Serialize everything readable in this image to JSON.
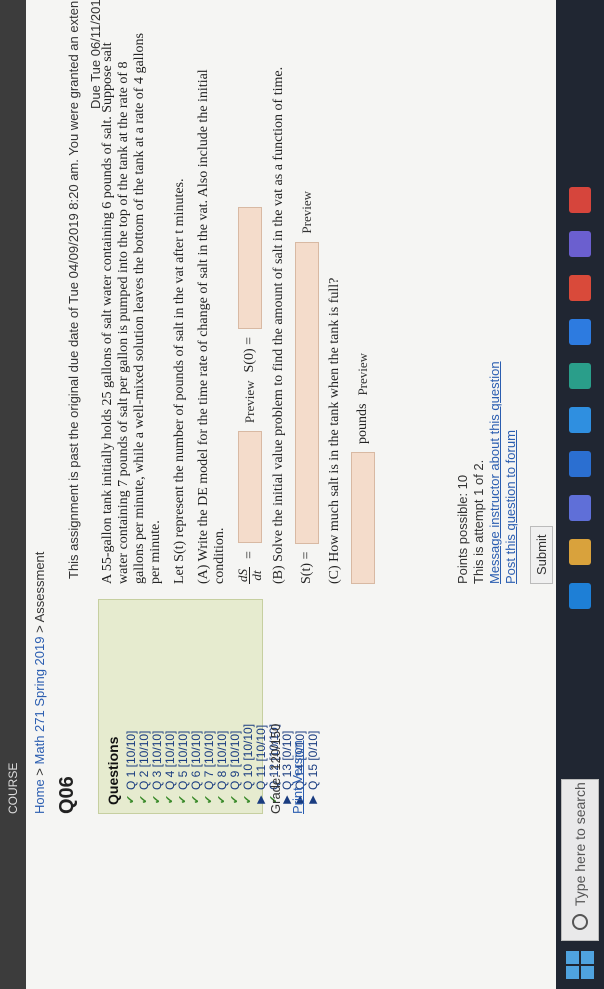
{
  "taskbar": {
    "search_placeholder": "Type here to search",
    "apps": [
      "edge-icon",
      "explorer-icon",
      "store-icon",
      "word-icon",
      "mail-icon",
      "maps-icon",
      "photos-icon",
      "media-icon",
      "teams-icon",
      "chrome-icon"
    ]
  },
  "header": {
    "brand": "COURSE",
    "breadcrumb": {
      "home": "Home",
      "sep": ">",
      "course": "Math 271 Spring 2019",
      "page": "Assessment"
    },
    "title": "Q06",
    "past_due": "This assignment is past the original due date of Tue 04/09/2019 8:20 am. You were granted an exten",
    "due": "Due Tue 06/11/2019 11:"
  },
  "sidebar": {
    "title": "Questions",
    "items": [
      {
        "label": "Q 1 [10/10]",
        "mark": "✔"
      },
      {
        "label": "Q 2 [10/10]",
        "mark": "✔"
      },
      {
        "label": "Q 3 [10/10]",
        "mark": "✔"
      },
      {
        "label": "Q 4 [10/10]",
        "mark": "✔"
      },
      {
        "label": "Q 5 [10/10]",
        "mark": "✔"
      },
      {
        "label": "Q 6 [10/10]",
        "mark": "✔"
      },
      {
        "label": "Q 7 [10/10]",
        "mark": "✔"
      },
      {
        "label": "Q 8 [10/10]",
        "mark": "✔"
      },
      {
        "label": "Q 9 [10/10]",
        "mark": "✔"
      },
      {
        "label": "Q 10 [10/10]",
        "mark": "✔"
      },
      {
        "label": "Q 11 [10/10]",
        "mark": "▶"
      },
      {
        "label": "Q 12 [10/10]",
        "mark": "✔"
      },
      {
        "label": "Q 13 [0/10]",
        "mark": "▶"
      },
      {
        "label": "Q 14 [0/10]",
        "mark": "▶"
      },
      {
        "label": "Q 15 [0/10]",
        "mark": "▶"
      }
    ],
    "grade": "Grade: 120/150",
    "print": "Print Version"
  },
  "question": {
    "prompt": "A 55-gallon tank initially holds 25 gallons of salt water containing 6 pounds of salt. Suppose salt water containing 7 pounds of salt per gallon is pumped into the top of the tank at the rate of 8 gallons per minute, while a well-mixed solution leaves the bottom of the tank at a rate of 4 gallons per minute.",
    "let": "Let S(t) represent the number of pounds of salt in the vat after t minutes.",
    "part_a": "(A) Write the DE model for the time rate of change of salt in the vat. Also include the initial condition.",
    "dsdt_num": "dS",
    "dsdt_den": "dt",
    "eq": "=",
    "preview": "Preview",
    "s0": "S(0) =",
    "part_b": "(B) Solve the initial value problem to find the amount of salt in the vat as a function of time.",
    "st": "S(t) =",
    "part_c": "(C) How much salt is in the tank when the tank is full?",
    "pounds": "pounds"
  },
  "footer": {
    "points": "Points possible: 10",
    "attempt": "This is attempt 1 of 2.",
    "message": "Message instructor about this question",
    "post": "Post this question to forum",
    "submit": "Submit"
  }
}
